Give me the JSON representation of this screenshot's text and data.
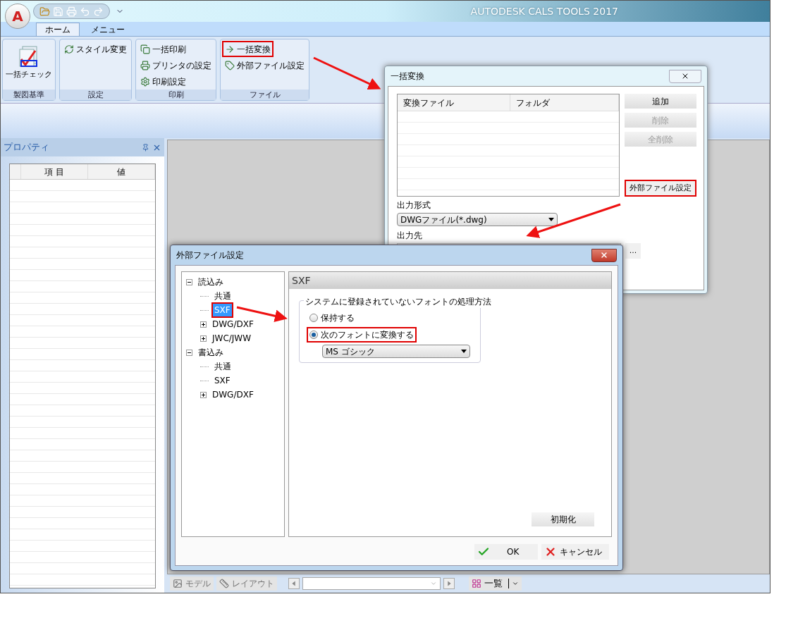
{
  "app": {
    "logo_letter": "A",
    "title": "AUTODESK CALS TOOLS 2017"
  },
  "ribbon_tabs": [
    {
      "label": "ホーム",
      "selected": true
    },
    {
      "label": "メニュー",
      "selected": false
    }
  ],
  "ribbon_groups": [
    {
      "label": "製図基準",
      "items": [
        {
          "label": "一括チェック",
          "kind": "large",
          "highlighted": false
        }
      ]
    },
    {
      "label": "設定",
      "items": [
        {
          "label": "スタイル変更",
          "kind": "small",
          "highlighted": false
        }
      ]
    },
    {
      "label": "印刷",
      "items": [
        {
          "label": "一括印刷",
          "kind": "small",
          "highlighted": false
        },
        {
          "label": "プリンタの設定",
          "kind": "small",
          "highlighted": false
        },
        {
          "label": "印刷設定",
          "kind": "small",
          "highlighted": false
        }
      ]
    },
    {
      "label": "ファイル",
      "items": [
        {
          "label": "一括変換",
          "kind": "small",
          "highlighted": true
        },
        {
          "label": "外部ファイル設定",
          "kind": "small",
          "highlighted": false
        }
      ]
    }
  ],
  "properties_panel": {
    "title": "プロパティ",
    "columns": [
      "項 目",
      "値"
    ]
  },
  "document_bar": {
    "model_tab": "モデル",
    "layout_tab": "レイアウト",
    "list_button": "一覧"
  },
  "batch_dialog": {
    "title": "一括変換",
    "columns": [
      "変換ファイル",
      "フォルダ"
    ],
    "buttons": [
      {
        "label": "追加",
        "disabled": false
      },
      {
        "label": "削除",
        "disabled": true
      },
      {
        "label": "全削除",
        "disabled": true
      }
    ],
    "external_button": {
      "label": "外部ファイル設定",
      "highlighted": true
    },
    "format_label": "出力形式",
    "format_value": "DWGファイル(*.dwg)",
    "dest_label": "出力先",
    "browse_button": "..."
  },
  "settings_dialog": {
    "title": "外部ファイル設定",
    "tree": [
      {
        "label": "読込み",
        "expanded": true,
        "selected": false,
        "children": [
          {
            "label": "共通",
            "selected": false,
            "highlighted": false
          },
          {
            "label": "SXF",
            "selected": true,
            "highlighted": true
          },
          {
            "label": "DWG/DXF",
            "expanded": false,
            "selected": false,
            "highlighted": false
          },
          {
            "label": "JWC/JWW",
            "expanded": false,
            "selected": false,
            "highlighted": false
          }
        ]
      },
      {
        "label": "書込み",
        "expanded": true,
        "selected": false,
        "children": [
          {
            "label": "共通",
            "selected": false,
            "highlighted": false
          },
          {
            "label": "SXF",
            "selected": false,
            "highlighted": false
          },
          {
            "label": "DWG/DXF",
            "expanded": false,
            "selected": false,
            "highlighted": false
          }
        ]
      }
    ],
    "page_title": "SXF",
    "group_title": "システムに登録されていないフォントの処理方法",
    "options": [
      {
        "label": "保持する",
        "selected": false,
        "highlighted": false
      },
      {
        "label": "次のフォントに変換する",
        "selected": true,
        "highlighted": true
      }
    ],
    "font_value": "MS ゴシック",
    "reset_button": "初期化",
    "ok_button": "OK",
    "cancel_button": "キャンセル"
  }
}
